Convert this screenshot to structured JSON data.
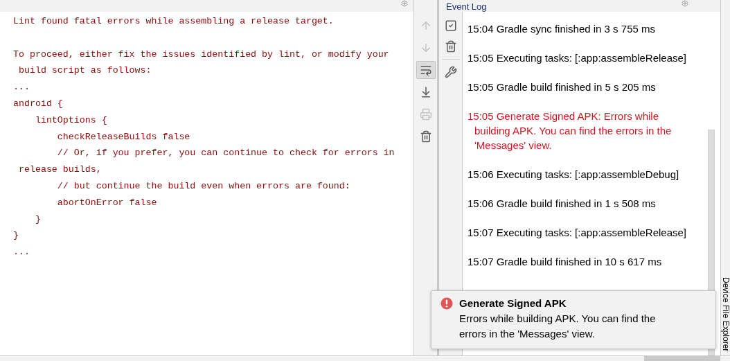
{
  "console": {
    "paragraphs": [
      [
        "Lint found fatal errors while assembling a release target."
      ],
      [
        "To proceed, either fix the issues identified by lint, or modify your",
        " build script as follows:",
        "...",
        "android {",
        "    lintOptions {",
        "        checkReleaseBuilds false",
        "        // Or, if you prefer, you can continue to check for errors in",
        " release builds,",
        "        // but continue the build even when errors are found:",
        "        abortOnError false",
        "    }",
        "}",
        "..."
      ]
    ]
  },
  "console_toolbar": [
    {
      "kind": "up",
      "disabled": true,
      "selected": false
    },
    {
      "kind": "down",
      "disabled": true,
      "selected": false
    },
    {
      "kind": "wrap",
      "disabled": false,
      "selected": true
    },
    {
      "kind": "scroll-end",
      "disabled": false,
      "selected": false
    },
    {
      "kind": "print",
      "disabled": true,
      "selected": false
    },
    {
      "kind": "trash",
      "disabled": false,
      "selected": false
    }
  ],
  "event_log": {
    "title": "Event Log",
    "toolbar": [
      {
        "kind": "check"
      },
      {
        "kind": "trash"
      },
      {
        "kind": "wrench"
      }
    ],
    "entries": [
      {
        "text": "15:04 Gradle sync finished in 3 s 755 ms",
        "error": false
      },
      {
        "text": "15:05 Executing tasks: [:app:assembleRelease]",
        "error": false
      },
      {
        "text": "15:05 Gradle build finished in 5 s 205 ms",
        "error": false
      },
      {
        "text": "15:05 Generate Signed APK: Errors while building APK. You can find the errors in the 'Messages' view.",
        "error": true
      },
      {
        "text": "15:06 Executing tasks: [:app:assembleDebug]",
        "error": false
      },
      {
        "text": "15:06 Gradle build finished in 1 s 508 ms",
        "error": false
      },
      {
        "text": "15:07 Executing tasks: [:app:assembleRelease]",
        "error": false
      },
      {
        "text": "15:07 Gradle build finished in 10 s 617 ms",
        "error": false
      }
    ]
  },
  "side_tab": {
    "label": "Device File Explorer"
  },
  "notification": {
    "title": "Generate Signed APK",
    "message": "Errors while building APK. You can find the errors in the 'Messages' view."
  }
}
